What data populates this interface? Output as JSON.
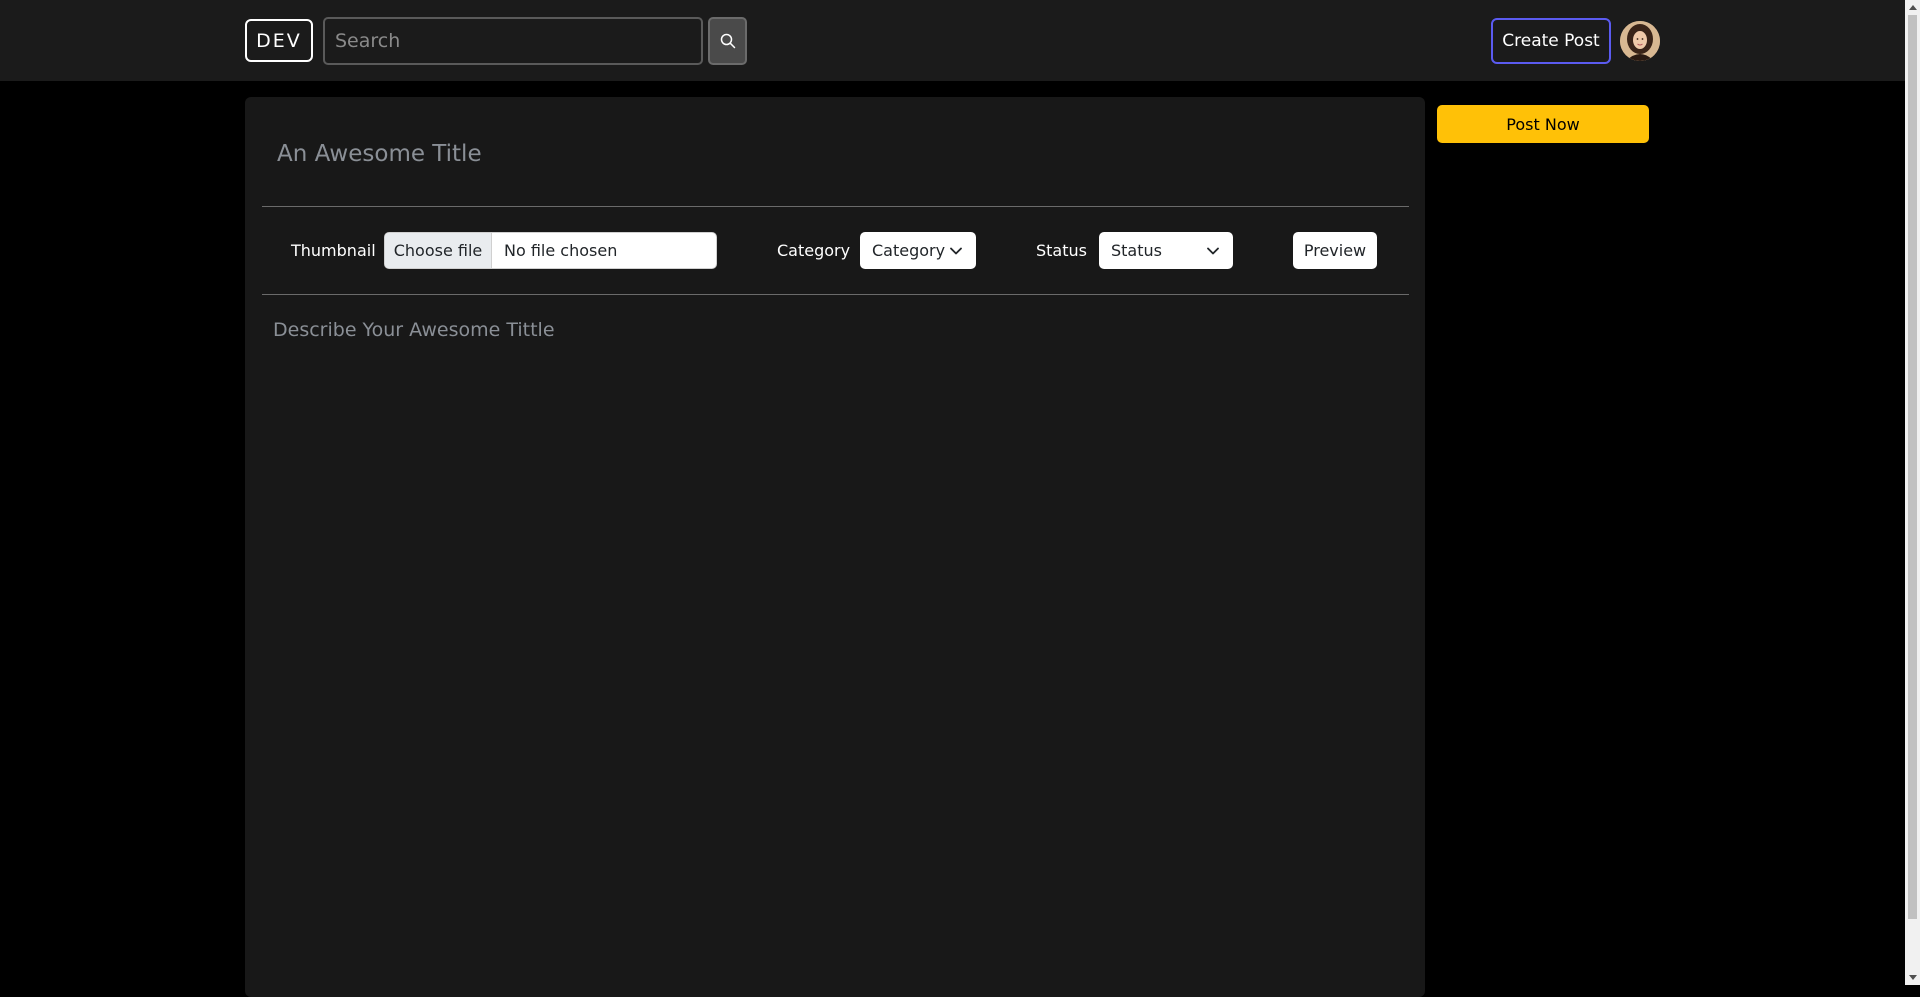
{
  "navbar": {
    "logo_text": "DEV",
    "search_placeholder": "Search",
    "create_post_label": "Create Post"
  },
  "editor": {
    "title_placeholder": "An Awesome Title",
    "thumbnail_label": "Thumbnail",
    "file_button_label": "Choose file",
    "file_status": "No file chosen",
    "category_label": "Category",
    "category_selected": "Category",
    "status_label": "Status",
    "status_selected": "Status",
    "preview_label": "Preview",
    "description_placeholder": "Describe Your Awesome Tittle"
  },
  "sidebar": {
    "post_now_label": "Post Now"
  },
  "colors": {
    "page_bg": "#000000",
    "navbar_bg": "#1b1b1b",
    "card_bg": "#181818",
    "accent_create_post": "#5b5bf0",
    "post_now_bg": "#ffc107"
  },
  "icons": {
    "search": "search-icon",
    "chevron": "chevron-down-icon",
    "avatar": "user-avatar"
  }
}
